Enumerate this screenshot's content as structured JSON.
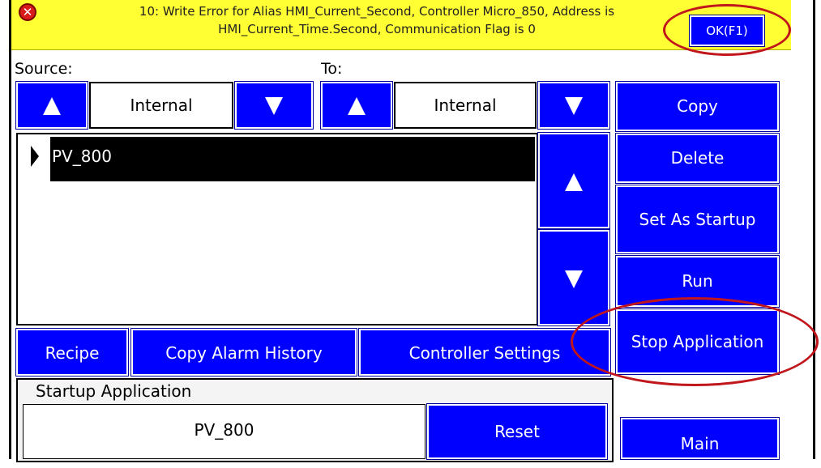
{
  "alert": {
    "message_line1": "10: Write Error for Alias HMI_Current_Second, Controller Micro_850, Address is",
    "message_line2": "HMI_Current_Time.Second, Communication Flag is 0",
    "ok_label": "OK(F1)",
    "icon": "error-x-icon"
  },
  "source": {
    "label": "Source:",
    "value": "Internal"
  },
  "to": {
    "label": "To:",
    "value": "Internal"
  },
  "side_buttons": {
    "copy": "Copy",
    "delete": "Delete",
    "set_as_startup": "Set As Startup",
    "run": "Run",
    "stop_application": "Stop Application",
    "main": "Main"
  },
  "application_list": {
    "items": [
      "PV_800"
    ]
  },
  "bottom_buttons": {
    "recipe": "Recipe",
    "copy_alarm_history": "Copy Alarm History",
    "controller_settings": "Controller Settings"
  },
  "startup": {
    "title": "Startup Application",
    "value": "PV_800",
    "reset_label": "Reset"
  },
  "colors": {
    "button_blue": "#0000ff",
    "alert_yellow": "#ffff33",
    "highlight_ring": "#c0161c"
  }
}
